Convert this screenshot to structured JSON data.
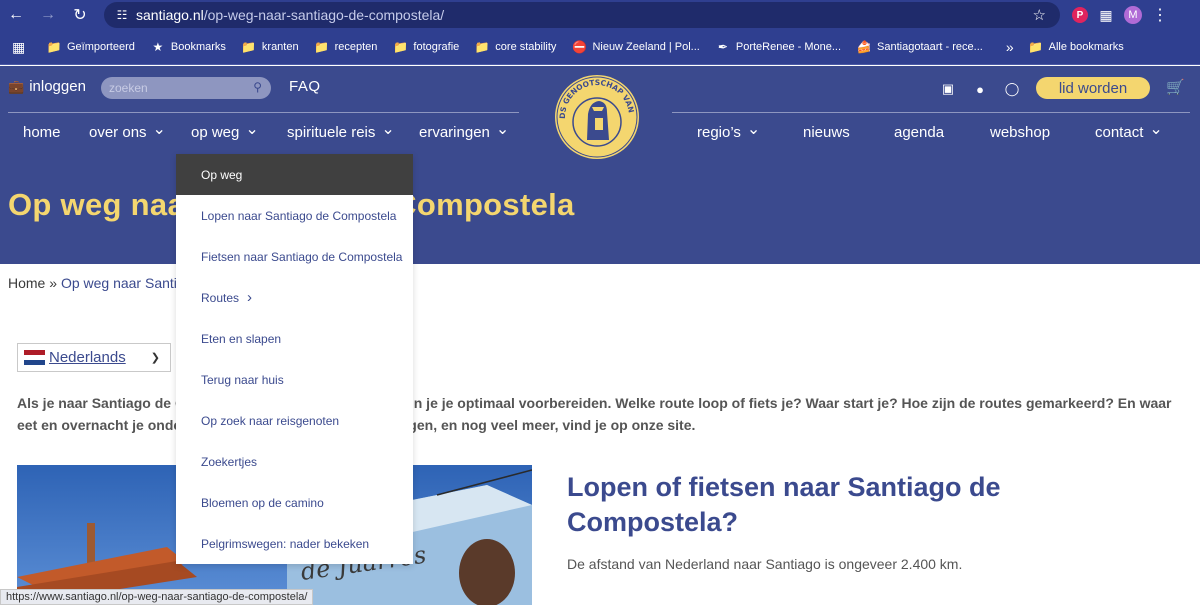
{
  "browser": {
    "url_host": "santiago.nl",
    "url_path": "/op-weg-naar-santiago-de-compostela/",
    "avatar_letter": "M",
    "bookmarks": [
      {
        "icon": "folder-icon",
        "label": "Geïmporteerd"
      },
      {
        "icon": "star-icon",
        "label": "Bookmarks"
      },
      {
        "icon": "folder-icon",
        "label": "kranten"
      },
      {
        "icon": "folder-icon",
        "label": "recepten"
      },
      {
        "icon": "folder-icon",
        "label": "fotografie"
      },
      {
        "icon": "folder-icon",
        "label": "core stability"
      },
      {
        "icon": "no-entry-icon",
        "label": "Nieuw Zeeland | Pol..."
      },
      {
        "icon": "feather-icon",
        "label": "PorteRenee - Mone..."
      },
      {
        "icon": "cake-icon",
        "label": "Santiagotaart - rece..."
      }
    ],
    "bookmarks_more": "»",
    "other_bookmarks": "Alle bookmarks",
    "status_url": "https://www.santiago.nl/op-weg-naar-santiago-de-compostela/"
  },
  "header": {
    "login": "inloggen",
    "search_placeholder": "zoeken",
    "faq": "FAQ",
    "join": "lid worden",
    "logo_text": "NEDERLANDS GENOOTSCHAP VAN SINT JACOB",
    "nav_left": [
      {
        "label": "home",
        "has_chevron": false
      },
      {
        "label": "over ons",
        "has_chevron": true
      },
      {
        "label": "op weg",
        "has_chevron": true
      },
      {
        "label": "spirituele reis",
        "has_chevron": true
      },
      {
        "label": "ervaringen",
        "has_chevron": true
      }
    ],
    "nav_right": [
      {
        "label": "regio’s",
        "has_chevron": true
      },
      {
        "label": "nieuws",
        "has_chevron": false
      },
      {
        "label": "agenda",
        "has_chevron": false
      },
      {
        "label": "webshop",
        "has_chevron": false
      },
      {
        "label": "contact",
        "has_chevron": true
      }
    ],
    "hero_title": "Op weg naar Santiago de Compostela"
  },
  "dropdown": {
    "items": [
      {
        "label": "Op weg",
        "active": true,
        "has_sub": false
      },
      {
        "label": "Lopen naar Santiago de Compostela",
        "active": false,
        "has_sub": false
      },
      {
        "label": "Fietsen naar Santiago de Compostela",
        "active": false,
        "has_sub": false
      },
      {
        "label": "Routes",
        "active": false,
        "has_sub": true
      },
      {
        "label": "Eten en slapen",
        "active": false,
        "has_sub": false
      },
      {
        "label": "Terug naar huis",
        "active": false,
        "has_sub": false
      },
      {
        "label": "Op zoek naar reisgenoten",
        "active": false,
        "has_sub": false
      },
      {
        "label": "Zoekertjes",
        "active": false,
        "has_sub": false
      },
      {
        "label": "Bloemen op de camino",
        "active": false,
        "has_sub": false
      },
      {
        "label": "Pelgrimswegen: nader bekeken",
        "active": false,
        "has_sub": false
      }
    ]
  },
  "content": {
    "breadcrumb_home": "Home",
    "breadcrumb_sep": " » ",
    "breadcrumb_current": "Op weg naar Santiago de Compostela",
    "language": "Nederlands",
    "intro": "Als je naar Santiago de Compostela wilt lopen of fietsen, kun je je optimaal voorbereiden. Welke route loop of fiets je? Waar start je? Hoe zijn de routes gemarkeerd? En waar eet en overnacht je onderweg? De antwoorden op deze vragen, en nog veel meer, vind je op onze site.",
    "section_title": "Lopen of fietsen naar Santiago de Compostela?",
    "section_text": "De afstand van Nederland naar Santiago is ongeveer 2.400 km.",
    "photo_sign_text": "de Juarros"
  },
  "colors": {
    "brand_blue": "#3b4a8e",
    "brand_yellow": "#f4d66f",
    "browser_blue": "#2f3f90"
  }
}
